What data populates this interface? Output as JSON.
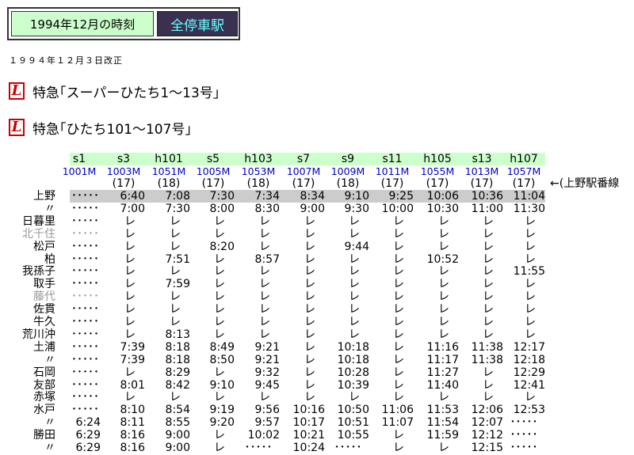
{
  "header": {
    "title_left": "1994年12月の時刻",
    "title_right": "全停車駅"
  },
  "revision": "１９９４年１２月３日改正",
  "train_lines": [
    {
      "name": "特急｢スーパーひたち1～13号｣",
      "icon": "limited-express-icon"
    },
    {
      "name": "特急｢ひたち101～107号｣",
      "icon": "limited-express-icon"
    }
  ],
  "timetable": {
    "columns": [
      "s1",
      "s3",
      "h101",
      "s5",
      "h103",
      "s7",
      "s9",
      "s11",
      "h105",
      "s13",
      "h107"
    ],
    "train_numbers": [
      "1001M",
      "1003M",
      "1051M",
      "1005M",
      "1053M",
      "1007M",
      "1009M",
      "1011M",
      "1055M",
      "1013M",
      "1057M"
    ],
    "cars": [
      "",
      "(17)",
      "(18)",
      "(17)",
      "(18)",
      "(17)",
      "(18)",
      "(17)",
      "(17)",
      "(17)",
      "(17)"
    ],
    "note": "←(上野駅番線",
    "rows": [
      {
        "station": "上野",
        "dim": false,
        "times": [
          "･････",
          "6:40",
          "7:08",
          "7:30",
          "7:34",
          "8:34",
          "9:10",
          "9:25",
          "10:06",
          "10:36",
          "11:04"
        ]
      },
      {
        "station": "〃",
        "dim": false,
        "times": [
          "･････",
          "7:00",
          "7:30",
          "8:00",
          "8:30",
          "9:00",
          "9:30",
          "10:00",
          "10:30",
          "11:00",
          "11:30"
        ]
      },
      {
        "station": "日暮里",
        "dim": false,
        "times": [
          "･････",
          "レ",
          "レ",
          "レ",
          "レ",
          "レ",
          "レ",
          "レ",
          "レ",
          "レ",
          "レ"
        ]
      },
      {
        "station": "北千住",
        "dim": true,
        "times": [
          "･････",
          "レ",
          "レ",
          "レ",
          "レ",
          "レ",
          "レ",
          "レ",
          "レ",
          "レ",
          "レ"
        ]
      },
      {
        "station": "松戸",
        "dim": false,
        "times": [
          "･････",
          "レ",
          "レ",
          "8:20",
          "レ",
          "レ",
          "9:44",
          "レ",
          "レ",
          "レ",
          "レ"
        ]
      },
      {
        "station": "柏",
        "dim": false,
        "times": [
          "･････",
          "レ",
          "7:51",
          "レ",
          "8:57",
          "レ",
          "レ",
          "レ",
          "10:52",
          "レ",
          "レ"
        ]
      },
      {
        "station": "我孫子",
        "dim": false,
        "times": [
          "･････",
          "レ",
          "レ",
          "レ",
          "レ",
          "レ",
          "レ",
          "レ",
          "レ",
          "レ",
          "11:55"
        ]
      },
      {
        "station": "取手",
        "dim": false,
        "times": [
          "･････",
          "レ",
          "7:59",
          "レ",
          "レ",
          "レ",
          "レ",
          "レ",
          "レ",
          "レ",
          "レ"
        ]
      },
      {
        "station": "藤代",
        "dim": true,
        "times": [
          "･････",
          "レ",
          "レ",
          "レ",
          "レ",
          "レ",
          "レ",
          "レ",
          "レ",
          "レ",
          "レ"
        ]
      },
      {
        "station": "佐貫",
        "dim": false,
        "times": [
          "･････",
          "レ",
          "レ",
          "レ",
          "レ",
          "レ",
          "レ",
          "レ",
          "レ",
          "レ",
          "レ"
        ]
      },
      {
        "station": "牛久",
        "dim": false,
        "times": [
          "･････",
          "レ",
          "レ",
          "レ",
          "レ",
          "レ",
          "レ",
          "レ",
          "レ",
          "レ",
          "レ"
        ]
      },
      {
        "station": "荒川沖",
        "dim": false,
        "times": [
          "･････",
          "レ",
          "8:13",
          "レ",
          "レ",
          "レ",
          "レ",
          "レ",
          "レ",
          "レ",
          "レ"
        ]
      },
      {
        "station": "土浦",
        "dim": false,
        "times": [
          "･････",
          "7:39",
          "8:18",
          "8:49",
          "9:21",
          "レ",
          "10:18",
          "レ",
          "11:16",
          "11:38",
          "12:17"
        ]
      },
      {
        "station": "〃",
        "dim": false,
        "times": [
          "･････",
          "7:39",
          "8:18",
          "8:50",
          "9:21",
          "レ",
          "10:18",
          "レ",
          "11:17",
          "11:38",
          "12:18"
        ]
      },
      {
        "station": "石岡",
        "dim": false,
        "times": [
          "･････",
          "レ",
          "8:29",
          "レ",
          "9:32",
          "レ",
          "10:28",
          "レ",
          "11:27",
          "レ",
          "12:29"
        ]
      },
      {
        "station": "友部",
        "dim": false,
        "times": [
          "･････",
          "8:01",
          "8:42",
          "9:10",
          "9:45",
          "レ",
          "10:39",
          "レ",
          "11:40",
          "レ",
          "12:41"
        ]
      },
      {
        "station": "赤塚",
        "dim": false,
        "times": [
          "･････",
          "レ",
          "レ",
          "レ",
          "レ",
          "レ",
          "レ",
          "レ",
          "レ",
          "レ",
          "レ"
        ]
      },
      {
        "station": "水戸",
        "dim": false,
        "times": [
          "･････",
          "8:10",
          "8:54",
          "9:19",
          "9:56",
          "10:16",
          "10:50",
          "11:06",
          "11:53",
          "12:06",
          "12:53"
        ]
      },
      {
        "station": "〃",
        "dim": false,
        "times": [
          "6:24",
          "8:11",
          "8:55",
          "9:20",
          "9:57",
          "10:17",
          "10:51",
          "11:07",
          "11:54",
          "12:07",
          "･････"
        ]
      },
      {
        "station": "勝田",
        "dim": false,
        "times": [
          "6:29",
          "8:16",
          "9:00",
          "レ",
          "10:02",
          "10:21",
          "10:55",
          "レ",
          "11:59",
          "12:12",
          "･････"
        ]
      },
      {
        "station": "〃",
        "dim": false,
        "times": [
          "6:29",
          "8:16",
          "9:00",
          "レ",
          "･････",
          "10:24",
          "･････",
          "レ",
          "レ",
          "12:15",
          "･････"
        ]
      }
    ]
  }
}
